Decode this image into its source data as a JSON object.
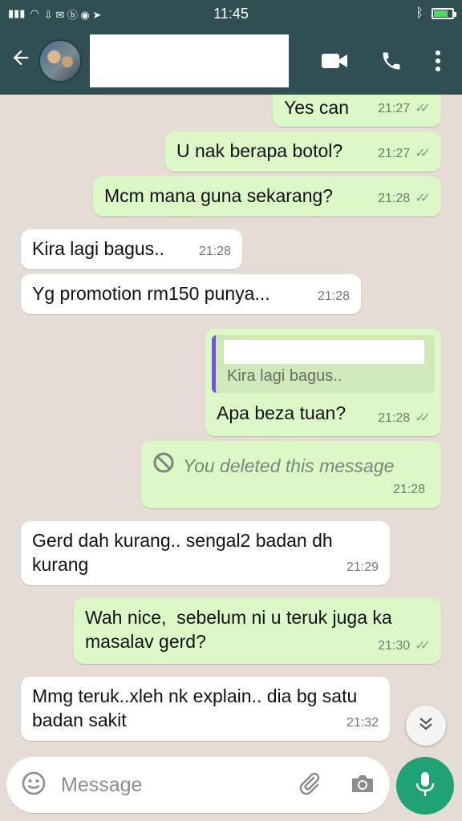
{
  "status_bar": {
    "time": "11:45"
  },
  "header": {
    "contact_name": ""
  },
  "messages": [
    {
      "dir": "out",
      "text": "Yes can",
      "time": "21:27"
    },
    {
      "dir": "out",
      "text": "U nak berapa botol?",
      "time": "21:27"
    },
    {
      "dir": "out",
      "text": "Mcm mana guna sekarang?",
      "time": "21:28"
    },
    {
      "dir": "in",
      "text": "Kira lagi bagus..",
      "time": "21:28"
    },
    {
      "dir": "in",
      "text": "Yg promotion rm150 punya...",
      "time": "21:28"
    },
    {
      "dir": "out",
      "quote_text": "Kira lagi bagus..",
      "text": "Apa beza tuan?",
      "time": "21:28"
    },
    {
      "dir": "out",
      "text": "You deleted this message",
      "time": "21:28"
    },
    {
      "dir": "in",
      "text": "Gerd dah kurang.. sengal2 badan dh kurang",
      "time": "21:29"
    },
    {
      "dir": "out",
      "text": "Wah nice,  sebelum ni u teruk juga ka masalav gerd?",
      "time": "21:30"
    },
    {
      "dir": "in",
      "text": "Mmg teruk..xleh nk explain.. dia bg satu badan sakit",
      "time": "21:32"
    }
  ],
  "composer": {
    "placeholder": "Message"
  },
  "colors": {
    "header": "#2f4f53",
    "outgoing": "#dcf8c6",
    "incoming": "#ffffff",
    "mic": "#1fa374",
    "background": "#e5ddd5"
  },
  "icons": [
    "back-arrow-icon",
    "video-call-icon",
    "phone-icon",
    "more-vert-icon",
    "emoji-icon",
    "attach-icon",
    "camera-icon",
    "mic-icon",
    "chevrons-down-icon",
    "deleted-icon",
    "double-check-icon"
  ]
}
